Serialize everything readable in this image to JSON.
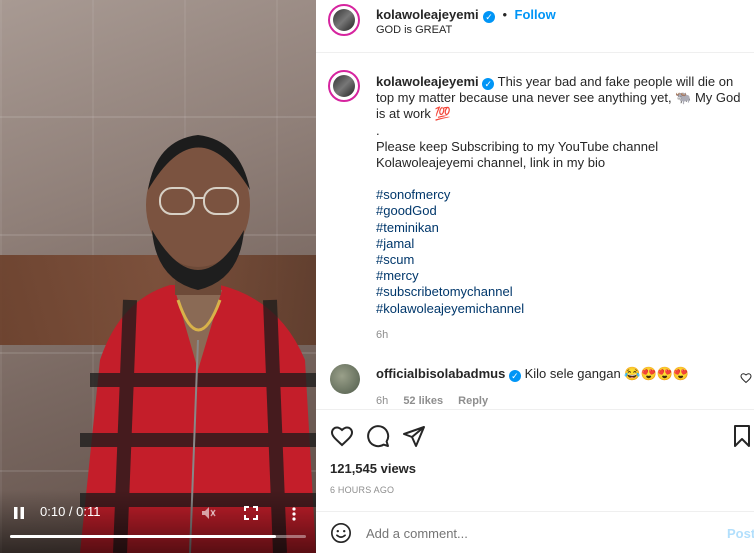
{
  "video": {
    "time": "0:10 / 0:11",
    "progress": 0.9
  },
  "header": {
    "username": "kolawoleajeyemi",
    "follow_label": "Follow",
    "subtitle": "GOD is GREAT",
    "separator": "•"
  },
  "caption": {
    "username": "kolawoleajeyemi",
    "text1": "This year bad and fake people will die on top my matter because una never see anything yet, 🐃 My God is at work 💯",
    "dot": ".",
    "text2": "Please keep Subscribing to my YouTube channel Kolawoleajeyemi channel, link in my bio",
    "hashtags": [
      "#sonofmercy",
      "#goodGod",
      "#teminikan",
      "#jamal",
      "#scum",
      "#mercy",
      "#subscribetomychannel",
      "#kolawoleajeyemichannel"
    ],
    "time": "6h"
  },
  "comment": {
    "username": "officialbisolabadmus",
    "text": "Kilo sele gangan 😂😍😍😍",
    "time": "6h",
    "likes": "52 likes",
    "reply": "Reply"
  },
  "stats": {
    "views": "121,545 views",
    "posted": "6 HOURS AGO"
  },
  "add_comment": {
    "placeholder": "Add a comment...",
    "post_label": "Post"
  },
  "colors": {
    "accent": "#0095f6",
    "hashtag": "#00376b",
    "muted": "#8e8e8e"
  }
}
